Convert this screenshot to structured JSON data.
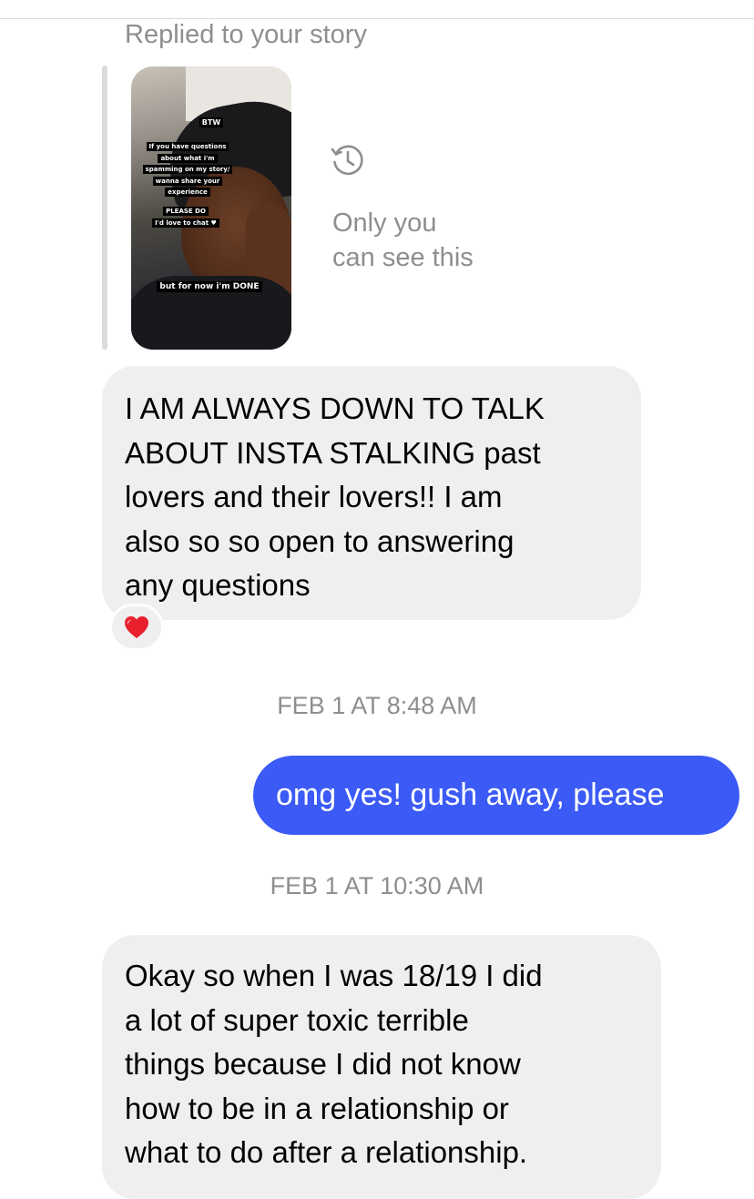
{
  "thread": {
    "replied_label": "Replied to your story",
    "story_caption": {
      "btw": "BTW",
      "questions": [
        "If you have questions",
        "about what i'm",
        "spamming on my story/",
        "wanna share your",
        "experience"
      ],
      "please": [
        "PLEASE DO",
        "I'd love to chat ♥"
      ],
      "done": "but for now i'm DONE"
    },
    "visibility_icon": "history-icon",
    "visibility_text_line1": "Only you",
    "visibility_text_line2": "can see this"
  },
  "messages": [
    {
      "side": "received",
      "lines": [
        "I AM ALWAYS DOWN TO TALK",
        "ABOUT INSTA STALKING past",
        "lovers and their lovers!! I am",
        "also so so open to answering",
        "any questions"
      ],
      "reaction": "heart-icon"
    },
    {
      "side": "timestamp",
      "text": "FEB 1 AT 8:48 AM"
    },
    {
      "side": "sent",
      "text": "omg yes! gush away, please"
    },
    {
      "side": "timestamp",
      "text": "FEB 1 AT 10:30 AM"
    },
    {
      "side": "received",
      "lines": [
        "Okay so when I was 18/19 I did",
        "a lot of super toxic terrible",
        "things because I did not know",
        "how to be in a relationship or",
        "what to do after a relationship."
      ]
    }
  ],
  "colors": {
    "sent_bubble": "#3b5af6",
    "received_bubble": "#efefef",
    "muted_text": "#8e8e8e",
    "reaction_heart": "#e8202e"
  }
}
